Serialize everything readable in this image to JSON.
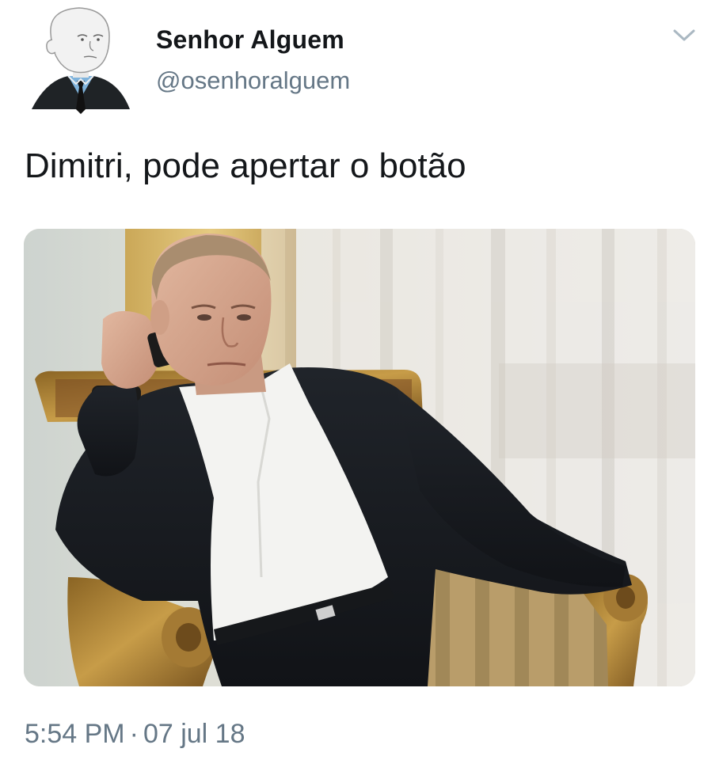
{
  "author": {
    "display_name": "Senhor Alguem",
    "handle": "@osenhoralguem",
    "avatar_icon": "wojak-suit-avatar"
  },
  "tweet": {
    "text": "Dimitri, pode apertar o botão",
    "media": {
      "alt": "",
      "icon": "photo-man-on-phone-in-armchair"
    },
    "time": "5:54 PM",
    "separator": "·",
    "date": "07 jul 18"
  },
  "icons": {
    "more": "chevron-down-icon"
  },
  "colors": {
    "text_primary": "#14171a",
    "text_secondary": "#657786",
    "chevron": "#aab8c2",
    "background": "#ffffff"
  }
}
